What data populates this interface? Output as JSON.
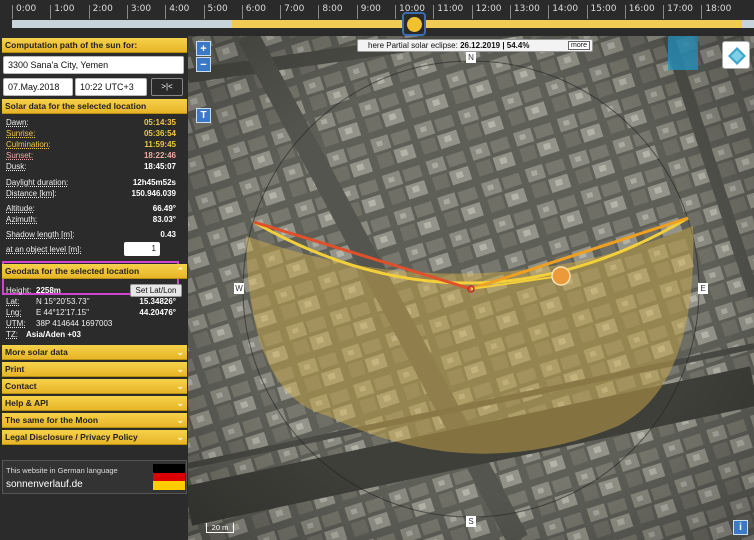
{
  "timeline": {
    "hours": [
      "0:00",
      "1:00",
      "2:00",
      "3:00",
      "4:00",
      "5:00",
      "6:00",
      "7:00",
      "8:00",
      "9:00",
      "10:00",
      "11:00",
      "12:00",
      "13:00",
      "14:00",
      "15:00",
      "16:00",
      "17:00",
      "18:00"
    ]
  },
  "sidebar": {
    "computation_header": "Computation path of the sun for:",
    "location_value": "3300 Sana'a City, Yemen",
    "date_value": "07.May.2018",
    "time_value": "10:22 UTC+3",
    "reset_button": ">|<",
    "solar_header": "Solar data for the selected location",
    "solar_rows": [
      {
        "label": "Dawn:",
        "value": "05:14:35"
      },
      {
        "label": "Sunrise:",
        "value": "05:36:54"
      },
      {
        "label": "Culmination:",
        "value": "11:59:45"
      },
      {
        "label": "Sunset:",
        "value": "18:22:46"
      },
      {
        "label": "Dusk:",
        "value": "18:45:07"
      },
      {
        "label": "Daylight duration:",
        "value": "12h45m52s"
      },
      {
        "label": "Distance [km]:",
        "value": "150.946.039"
      },
      {
        "label": "Altitude:",
        "value": "66.49°"
      },
      {
        "label": "Azimuth:",
        "value": "83.03°"
      }
    ],
    "shadow_label": "Shadow length [m]:",
    "shadow_value": "0.43",
    "object_level_label": "at an object level [m]:",
    "object_level_value": "1",
    "geo_header": "Geodata for the selected location",
    "height_label": "Height:",
    "height_value": "2258m",
    "set_latlon_button": "Set Lat/Lon",
    "lat_label": "Lat:",
    "lat_dms": "N 15°20'53.73''",
    "lat_value": "15.34826°",
    "lng_label": "Lng:",
    "lng_dms": "E 44°12'17.15''",
    "lng_value": "44.20476°",
    "utm_label": "UTM:",
    "utm_value": "38P 414644 1697003",
    "tz_label": "TZ:",
    "tz_value": "Asia/Aden  +03",
    "menu": [
      "More solar data",
      "Print",
      "Contact",
      "Help & API",
      "The same for the Moon",
      "Legal Disclosure / Privacy Policy"
    ],
    "german_text": "This website in German language",
    "german_link": "sonnenverlauf.de"
  },
  "map": {
    "eclipse_text": "here Partial solar eclipse:",
    "eclipse_date": "26.12.2019 | 54.4%",
    "more_button": "more",
    "zoom_in": "+",
    "zoom_out": "−",
    "t_button": "T",
    "info_button": "i",
    "compass": {
      "n": "N",
      "s": "S",
      "w": "W",
      "e": "E"
    },
    "scale_label": "20 m"
  },
  "colors": {
    "accent": "#f0c63a",
    "panel": "#2b2b2b",
    "sunrise_line": "#e0502a",
    "sunset_line": "#f0a020",
    "sun_path": "#f5d23a"
  }
}
